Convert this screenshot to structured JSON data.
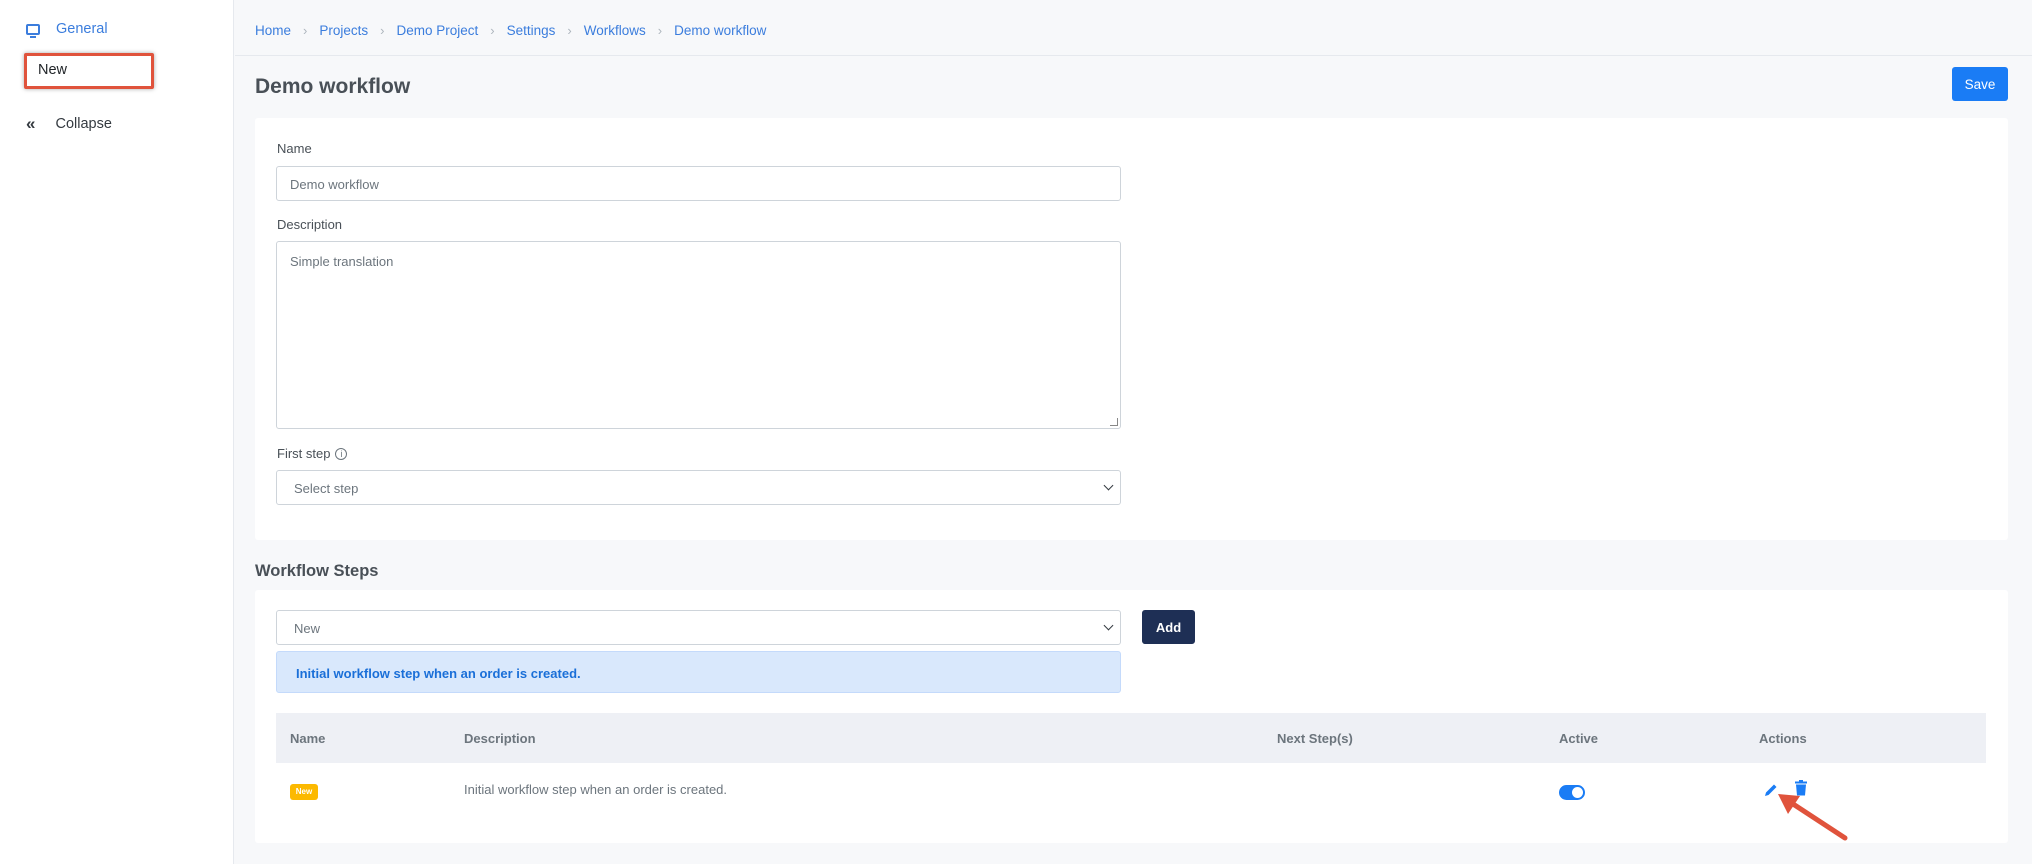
{
  "sidebar": {
    "general_label": "General",
    "new_label": "New",
    "collapse_label": "Collapse"
  },
  "breadcrumb": [
    "Home",
    "Projects",
    "Demo Project",
    "Settings",
    "Workflows",
    "Demo workflow"
  ],
  "page": {
    "title": "Demo workflow",
    "save_label": "Save"
  },
  "form": {
    "name_label": "Name",
    "name_value": "Demo workflow",
    "description_label": "Description",
    "description_value": "Simple translation",
    "first_step_label": "First step",
    "first_step_value": "Select step"
  },
  "steps": {
    "section_title": "Workflow Steps",
    "select_value": "New",
    "add_label": "Add",
    "alert_text": "Initial workflow step when an order is created.",
    "columns": [
      "Name",
      "Description",
      "Next Step(s)",
      "Active",
      "Actions"
    ],
    "rows": [
      {
        "name": "New",
        "description": "Initial workflow step when an order is created.",
        "next_steps": "",
        "active": true
      }
    ]
  },
  "colors": {
    "primary": "#1a7cf5",
    "dark_button": "#1e2f55",
    "badge": "#fcb900",
    "highlight": "#e0533c"
  }
}
